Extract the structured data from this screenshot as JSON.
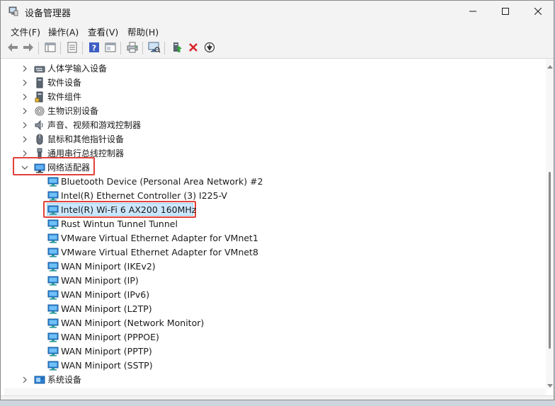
{
  "window": {
    "title": "设备管理器"
  },
  "menu": {
    "items": [
      "文件(F)",
      "操作(A)",
      "查看(V)",
      "帮助(H)"
    ]
  },
  "toolbar": {
    "buttons": [
      "back-icon",
      "forward-icon",
      "show-hide-tree-icon",
      "properties-icon",
      "help-icon",
      "view-icon",
      "print-icon",
      "scan-hardware-icon",
      "update-driver-icon",
      "uninstall-icon",
      "disable-icon"
    ]
  },
  "tree": {
    "collapsed_categories": [
      {
        "label": "人体学输入设备",
        "icon": "hid-icon"
      },
      {
        "label": "软件设备",
        "icon": "software-device-icon"
      },
      {
        "label": "软件组件",
        "icon": "software-component-icon"
      },
      {
        "label": "生物识别设备",
        "icon": "biometric-icon"
      },
      {
        "label": "声音、视频和游戏控制器",
        "icon": "speaker-icon"
      },
      {
        "label": "鼠标和其他指针设备",
        "icon": "mouse-icon"
      },
      {
        "label": "通用串行总线控制器",
        "icon": "usb-icon"
      }
    ],
    "expanded_category": {
      "label": "网络适配器",
      "icon": "network-adapter-icon",
      "children": [
        "Bluetooth Device (Personal Area Network) #2",
        "Intel(R) Ethernet Controller (3) I225-V",
        "Intel(R) Wi-Fi 6 AX200 160MHz",
        "Rust Wintun Tunnel Tunnel",
        "VMware Virtual Ethernet Adapter for VMnet1",
        "VMware Virtual Ethernet Adapter for VMnet8",
        "WAN Miniport (IKEv2)",
        "WAN Miniport (IP)",
        "WAN Miniport (IPv6)",
        "WAN Miniport (L2TP)",
        "WAN Miniport (Network Monitor)",
        "WAN Miniport (PPPOE)",
        "WAN Miniport (PPTP)",
        "WAN Miniport (SSTP)"
      ],
      "selected_index": 2
    },
    "trailing_category": {
      "label": "系统设备",
      "icon": "system-device-icon"
    }
  },
  "colors": {
    "highlight_border": "#e0413a",
    "selection_bg": "#cce8ff",
    "network_icon": "#2a7fd4"
  }
}
